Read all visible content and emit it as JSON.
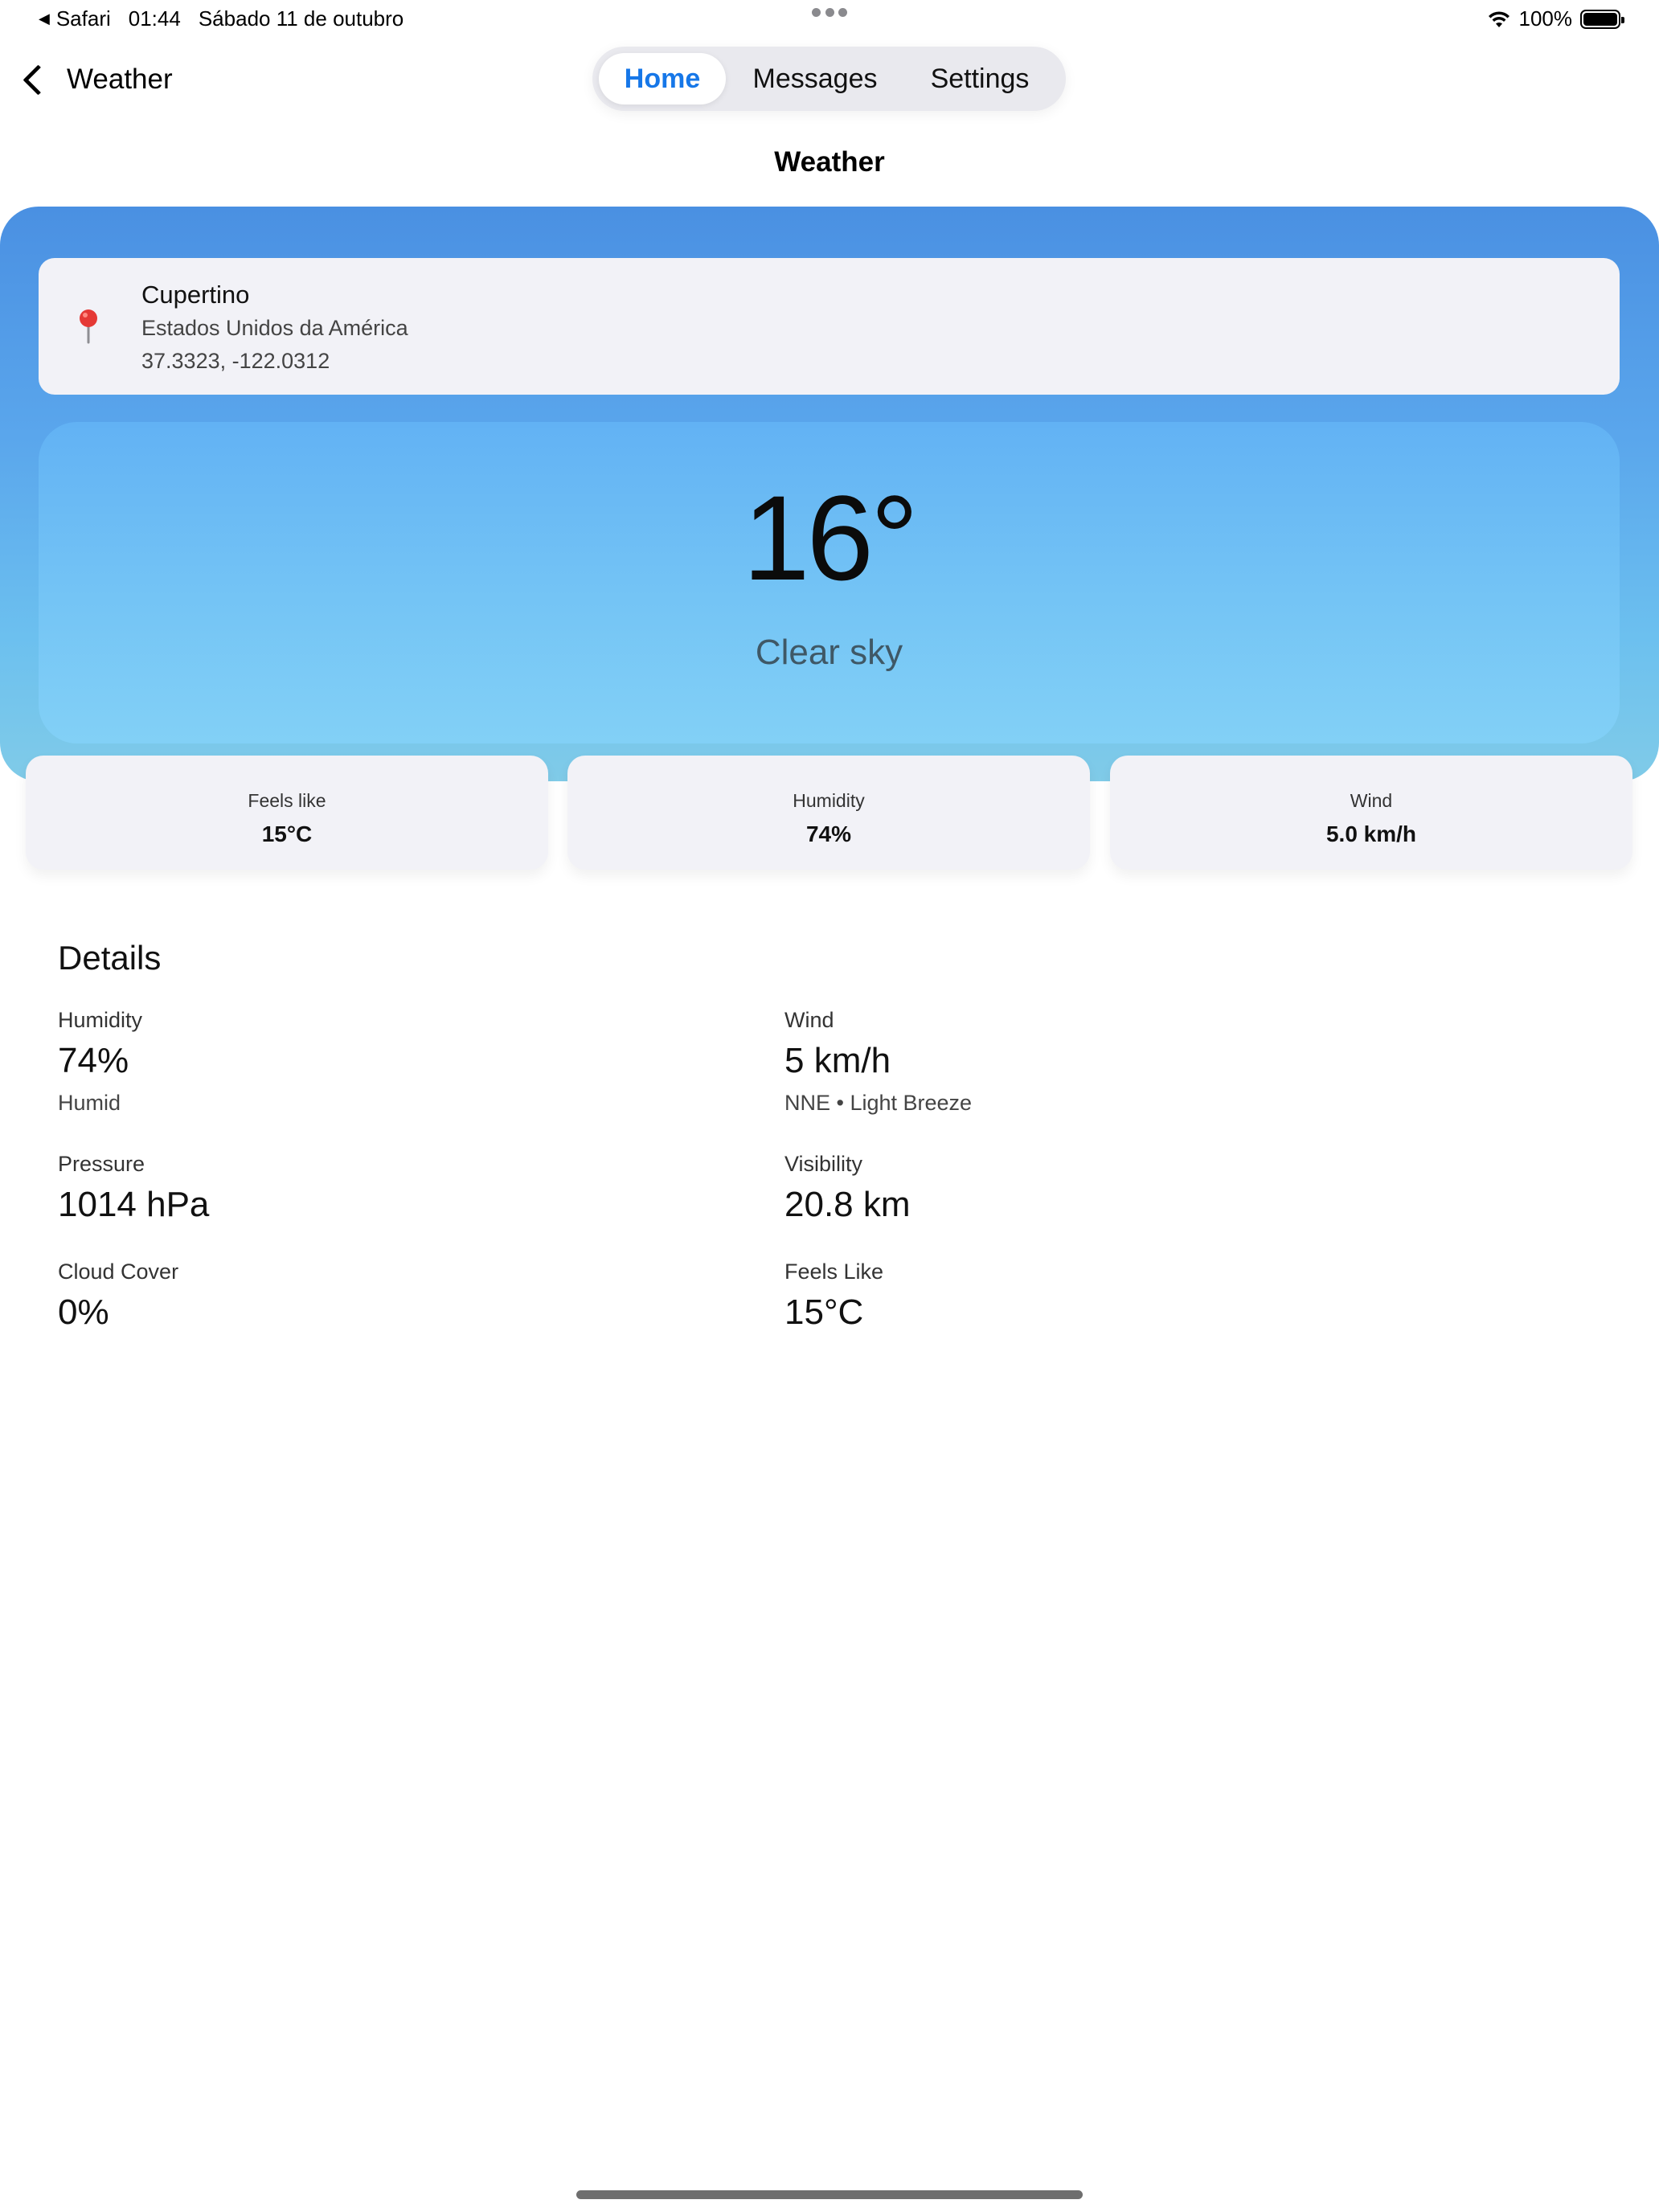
{
  "status_bar": {
    "back_app": "Safari",
    "time": "01:44",
    "date": "Sábado 11 de outubro",
    "battery": "100%"
  },
  "nav": {
    "back_label": "Weather",
    "tabs": [
      {
        "label": "Home",
        "active": true
      },
      {
        "label": "Messages",
        "active": false
      },
      {
        "label": "Settings",
        "active": false
      }
    ],
    "page_title": "Weather"
  },
  "location": {
    "city": "Cupertino",
    "country": "Estados Unidos da América",
    "coordinates": "37.3323, -122.0312"
  },
  "current": {
    "temperature": "16°",
    "condition": "Clear sky"
  },
  "summary": [
    {
      "label": "Feels like",
      "value": "15°C"
    },
    {
      "label": "Humidity",
      "value": "74%"
    },
    {
      "label": "Wind",
      "value": "5.0 km/h"
    }
  ],
  "details": {
    "title": "Details",
    "humidity": {
      "label": "Humidity",
      "value": "74%",
      "sub": "Humid"
    },
    "wind": {
      "label": "Wind",
      "value": "5 km/h",
      "sub": "NNE • Light Breeze"
    },
    "pressure": {
      "label": "Pressure",
      "value": "1014 hPa"
    },
    "visibility": {
      "label": "Visibility",
      "value": "20.8 km"
    },
    "cloud_cover": {
      "label": "Cloud Cover",
      "value": "0%"
    },
    "feels_like": {
      "label": "Feels Like",
      "value": "15°C"
    }
  },
  "colors": {
    "accent": "#1677e8",
    "hero_top": "#4a90e2",
    "hero_bottom": "#80cbe8",
    "pin": "#e53935"
  }
}
